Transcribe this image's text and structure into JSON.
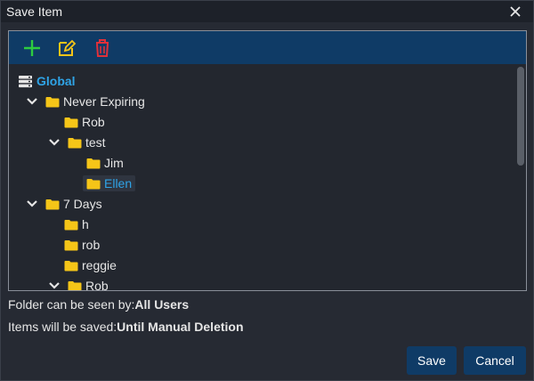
{
  "window": {
    "title": "Save Item"
  },
  "toolbar": {
    "add_icon": "plus-icon",
    "edit_icon": "edit-icon",
    "delete_icon": "trash-icon"
  },
  "tree": {
    "root": "Global",
    "items": [
      {
        "label": "Never Expiring",
        "expanded": true
      },
      {
        "label": "Rob"
      },
      {
        "label": "test",
        "expanded": true
      },
      {
        "label": "Jim"
      },
      {
        "label": "Ellen",
        "selected": true
      },
      {
        "label": "7 Days",
        "expanded": true
      },
      {
        "label": "h"
      },
      {
        "label": "rob"
      },
      {
        "label": "reggie"
      },
      {
        "label": "Rob",
        "expanded": true
      }
    ]
  },
  "info": {
    "visibility_label": "Folder can be seen by:",
    "visibility_value": "All Users",
    "retention_label": "Items will be saved:",
    "retention_value": "Until Manual Deletion"
  },
  "buttons": {
    "save": "Save",
    "cancel": "Cancel"
  },
  "colors": {
    "accent": "#2fa4e7",
    "toolbar": "#0f3b66",
    "folder": "#f5c518",
    "add": "#2ecc40",
    "edit": "#f5c518",
    "delete": "#e0303a"
  }
}
